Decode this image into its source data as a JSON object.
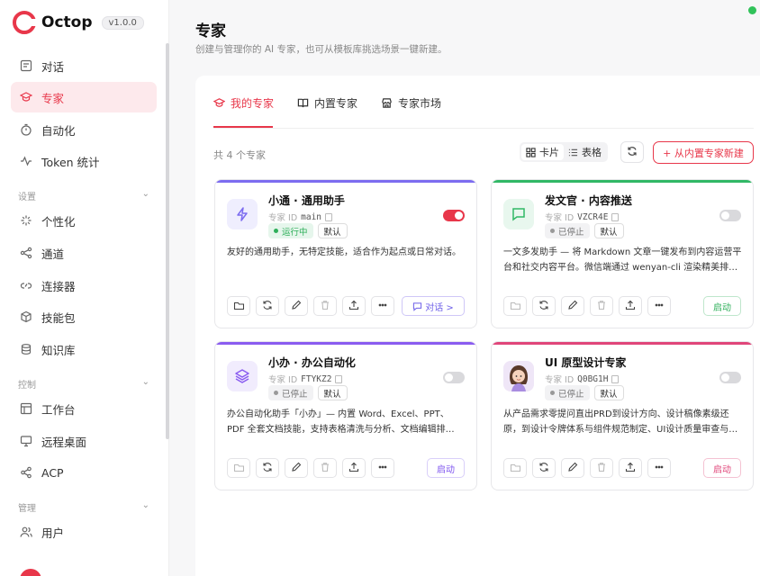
{
  "app": {
    "name": "Octop",
    "version": "v1.0.0"
  },
  "sidebar": {
    "items_top": [
      {
        "label": "对话",
        "icon": "chat-icon"
      },
      {
        "label": "专家",
        "icon": "graduation-cap-icon"
      },
      {
        "label": "自动化",
        "icon": "timer-icon"
      },
      {
        "label": "Token 统计",
        "icon": "activity-icon"
      }
    ],
    "group_settings": "设置",
    "items_settings": [
      {
        "label": "个性化",
        "icon": "sparkle-icon"
      },
      {
        "label": "通道",
        "icon": "channel-icon"
      },
      {
        "label": "连接器",
        "icon": "link-icon"
      },
      {
        "label": "技能包",
        "icon": "package-icon"
      },
      {
        "label": "知识库",
        "icon": "database-icon"
      }
    ],
    "group_control": "控制",
    "items_control": [
      {
        "label": "工作台",
        "icon": "workbench-icon"
      },
      {
        "label": "远程桌面",
        "icon": "monitor-icon"
      },
      {
        "label": "ACP",
        "icon": "share-icon"
      }
    ],
    "group_manage": "管理",
    "items_manage": [
      {
        "label": "用户",
        "icon": "users-icon"
      }
    ],
    "active": "专家"
  },
  "header": {
    "title": "专家",
    "subtitle": "创建与管理你的 AI 专家，也可从模板库挑选场景一键新建。"
  },
  "tabs": [
    {
      "label": "我的专家",
      "icon": "graduation-cap-icon"
    },
    {
      "label": "内置专家",
      "icon": "book-icon"
    },
    {
      "label": "专家市场",
      "icon": "store-icon"
    }
  ],
  "toolbar": {
    "count": "共 4 个专家",
    "view_card": "卡片",
    "view_table": "表格",
    "new_button": "+ 从内置专家新建"
  },
  "cards": [
    {
      "name": "小通 · 通用助手",
      "id_label": "专家 ID",
      "id": "main",
      "status": "运行中",
      "default": "默认",
      "enabled": true,
      "desc": "友好的通用助手，无特定技能，适合作为起点或日常对话。",
      "primary": "对话 >",
      "accent": "#7c6cf0",
      "icon": "lightning-icon"
    },
    {
      "name": "发文官 · 内容推送",
      "id_label": "专家 ID",
      "id": "VZCR4E",
      "status": "已停止",
      "default": "默认",
      "enabled": false,
      "desc": "一文多发助手 — 将 Markdown 文章一键发布到内容运营平台和社交内容平台。微信端通过 wenyan-cli 渲染精美排…",
      "primary": "启动",
      "accent": "#31b866",
      "icon": "message-square-icon"
    },
    {
      "name": "小办 · 办公自动化",
      "id_label": "专家 ID",
      "id": "FTYKZ2",
      "status": "已停止",
      "default": "默认",
      "enabled": false,
      "desc": "办公自动化助手「小办」— 内置 Word、Excel、PPT、PDF 全套文档技能，支持表格清洗与分析、文档编辑排…",
      "primary": "启动",
      "accent": "#8a5cf0",
      "icon": "layers-icon"
    },
    {
      "name": "UI 原型设计专家",
      "id_label": "专家 ID",
      "id": "Q0BG1H",
      "status": "已停止",
      "default": "默认",
      "enabled": false,
      "desc": "从产品需求零提问直出PRD到设计方向、设计稿像素级还原，到设计令牌体系与组件规范制定、UI设计质量审查与…",
      "primary": "启动",
      "accent": "#e0467a",
      "icon": "avatar-illustration"
    }
  ],
  "colors": {
    "brand": "#e8374a",
    "running": "#2eaf5a",
    "online_dot": "#31c25a"
  }
}
